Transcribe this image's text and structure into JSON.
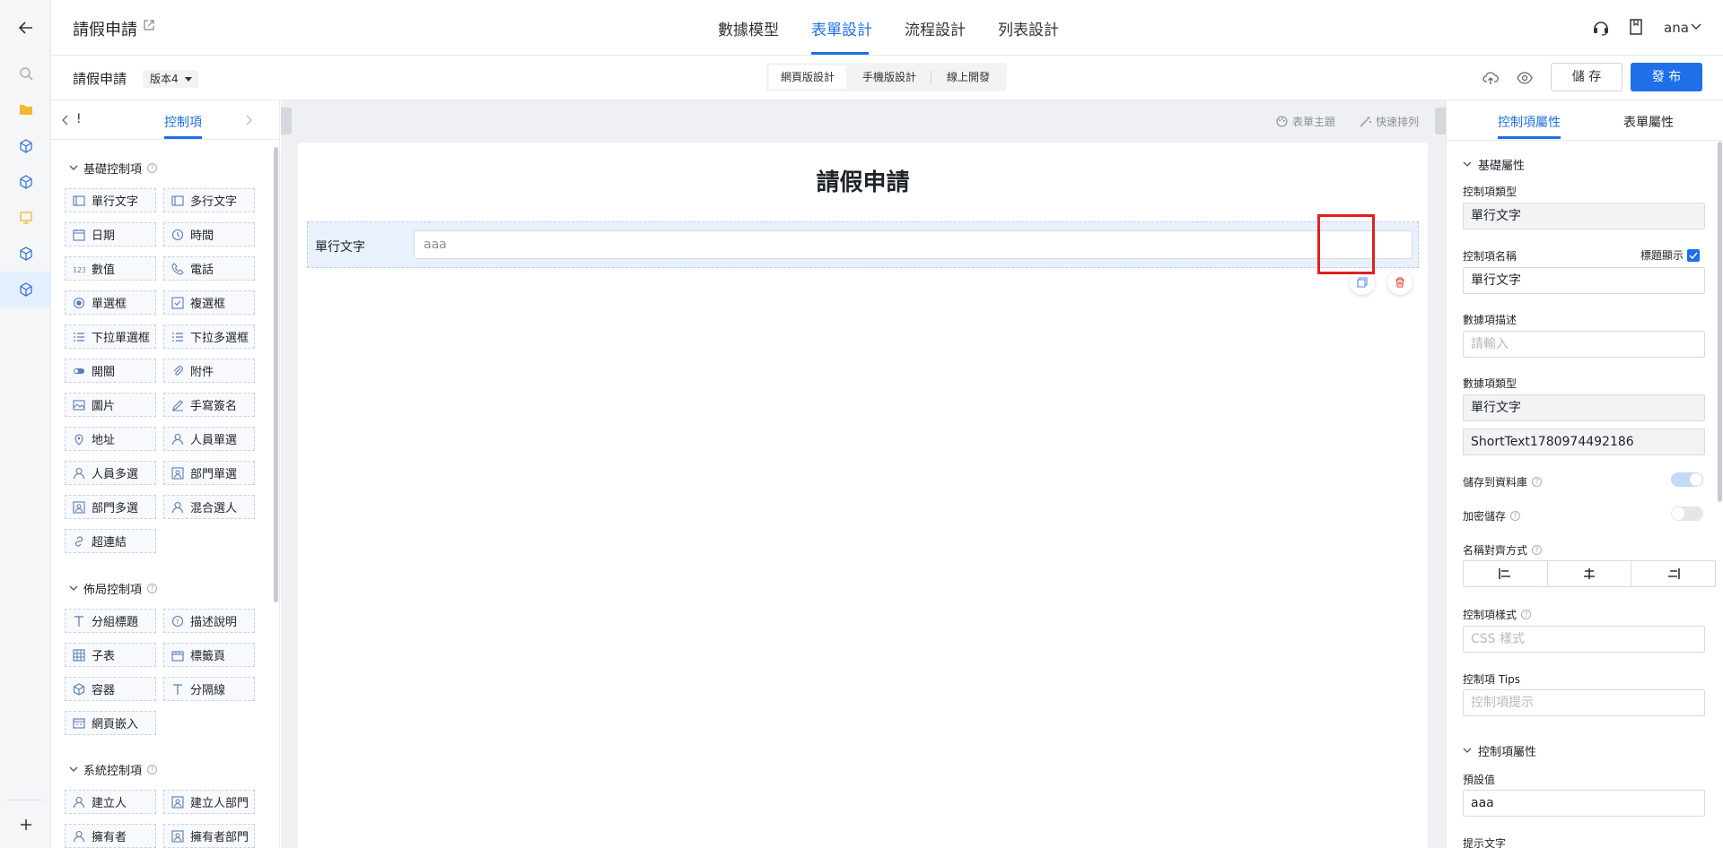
{
  "app": {
    "title": "請假申請",
    "user": "ana",
    "nav_tabs": [
      "數據模型",
      "表單設計",
      "流程設計",
      "列表設計"
    ],
    "active_tab_index": 1
  },
  "toolbar": {
    "form_name": "請假申請",
    "version": "版本4",
    "view_modes": [
      "網頁版設計",
      "手機版設計",
      "線上開發"
    ],
    "save_label": "儲 存",
    "publish_label": "發 布"
  },
  "left_panel": {
    "tab_left_glyph": "!",
    "tab_active": "控制項",
    "sections": {
      "basic": {
        "title": "基礎控制項",
        "items": [
          "單行文字",
          "多行文字",
          "日期",
          "時間",
          "數值",
          "電話",
          "單選框",
          "複選框",
          "下拉單選框",
          "下拉多選框",
          "開關",
          "附件",
          "圖片",
          "手寫簽名",
          "地址",
          "人員單選",
          "人員多選",
          "部門單選",
          "部門多選",
          "混合選人",
          "超連結"
        ]
      },
      "layout": {
        "title": "佈局控制項",
        "items": [
          "分組標題",
          "描述說明",
          "子表",
          "標籤頁",
          "容器",
          "分隔線",
          "網頁嵌入"
        ]
      },
      "system": {
        "title": "系統控制項",
        "items": [
          "建立人",
          "建立人部門",
          "擁有者",
          "擁有者部門"
        ]
      }
    }
  },
  "canvas": {
    "theme_label": "表單主題",
    "arrange_label": "快速排列",
    "form_title": "請假申請",
    "field": {
      "label": "單行文字",
      "value": "aaa"
    }
  },
  "right_panel": {
    "tabs": [
      "控制項屬性",
      "表單屬性"
    ],
    "basic_section": "基礎屬性",
    "control_type_label": "控制項類型",
    "control_type_value": "單行文字",
    "control_name_label": "控制項名稱",
    "show_title_label": "標題顯示",
    "show_title_checked": true,
    "control_name_value": "單行文字",
    "desc_label": "數據項描述",
    "desc_placeholder": "請輸入",
    "data_type_label": "數據項類型",
    "data_type_value": "單行文字",
    "field_id": "ShortText1780974492186",
    "save_db_label": "儲存到資料庫",
    "save_db_on": true,
    "encrypt_label": "加密儲存",
    "encrypt_on": false,
    "align_label": "名稱對齊方式",
    "style_label": "控制項樣式",
    "style_placeholder": "CSS 樣式",
    "tips_label": "控制項 Tips",
    "tips_placeholder": "控制項提示",
    "control_section": "控制項屬性",
    "default_label": "預設值",
    "default_value": "aaa",
    "hint_label": "提示文字"
  },
  "colors": {
    "accent": "#1e6fe8",
    "danger": "#e02020",
    "toggle_on": "#c5d8f7",
    "toggle_off": "#e4e6ea"
  }
}
